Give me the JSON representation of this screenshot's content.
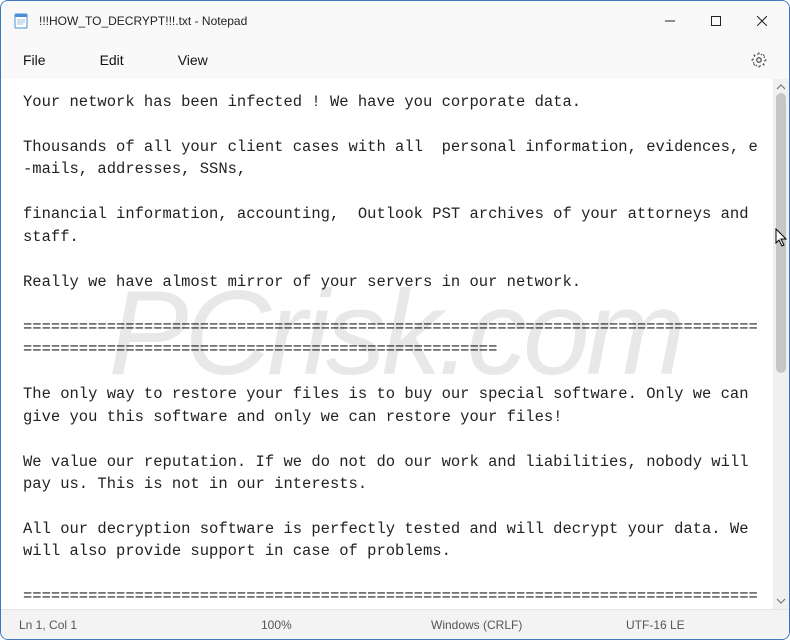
{
  "window": {
    "title": "!!!HOW_TO_DECRYPT!!!.txt - Notepad"
  },
  "menu": {
    "file": "File",
    "edit": "Edit",
    "view": "View"
  },
  "editor": {
    "text": "Your network has been infected ! We have you corporate data.\n\nThousands of all your client cases with all  personal information, evidences, e-mails, addresses, SSNs,\n\nfinancial information, accounting,  Outlook PST archives of your attorneys and staff.\n\nReally we have almost mirror of your servers in our network.\n\n==================================================================================================================================\n\nThe only way to restore your files is to buy our special software. Only we can give you this software and only we can restore your files!\n\nWe value our reputation. If we do not do our work and liabilities, nobody will pay us. This is not in our interests.\n\nAll our decryption software is perfectly tested and will decrypt your data. We will also provide support in case of problems.\n\n================================================================================="
  },
  "status": {
    "position": "Ln 1, Col 1",
    "zoom": "100%",
    "eol": "Windows (CRLF)",
    "encoding": "UTF-16 LE"
  },
  "watermark": "PCrisk.com"
}
